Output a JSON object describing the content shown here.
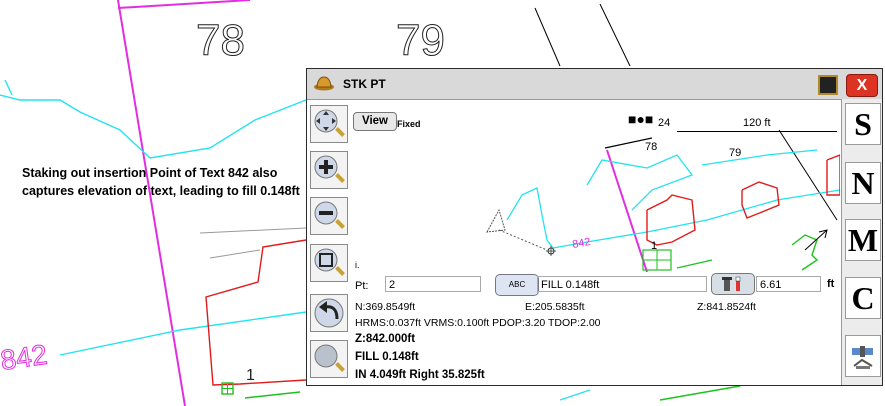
{
  "map_labels": {
    "lot_a": "78",
    "lot_b": "79",
    "text_point": "842",
    "point_one": "1"
  },
  "annotation": "Staking out insertion Point of Text 842 also captures elevation of text, leading to fill 0.148ft",
  "dialog": {
    "title": "STK PT",
    "close_label": "X",
    "view_button": "View",
    "view_mode": "Fixed",
    "scale_number": "24",
    "scale_label": "120 ft",
    "map_label_78": "78",
    "map_label_79": "79",
    "map_label_842": "842",
    "map_label_1": "1",
    "map_label_i": "i.",
    "point_label": "Pt:",
    "point_value": "2",
    "desc_button": "ABC",
    "description_value": "FILL 0.148ft",
    "height_value": "6.61",
    "height_unit": "ft",
    "north": "N:369.8549ft",
    "east": "E:205.5835ft",
    "elev": "Z:841.8524ft",
    "precision": "HRMS:0.037ft VRMS:0.100ft PDOP:3.20 TDOP:2.00",
    "design_z": "Z:842.000ft",
    "cutfill": "FILL 0.148ft",
    "offset": "IN 4.049ft Right 35.825ft"
  },
  "right_buttons": [
    "S",
    "N",
    "M",
    "C"
  ],
  "colors": {
    "cyan_line": "#22e3ef",
    "magenta_line": "#e22ee0",
    "red_polygon": "#e01b1b",
    "green_polygon": "#1ec21e",
    "close_red": "#dd3322"
  },
  "icons": [
    "hat-icon",
    "square-icon",
    "close-icon",
    "pan-icon",
    "zoom-in-icon",
    "zoom-out-icon",
    "zoom-extent-icon",
    "back-arrow-icon",
    "zoom-window-icon",
    "description-icon",
    "rod-height-icon",
    "satellite-icon",
    "scale-bar-icon"
  ]
}
